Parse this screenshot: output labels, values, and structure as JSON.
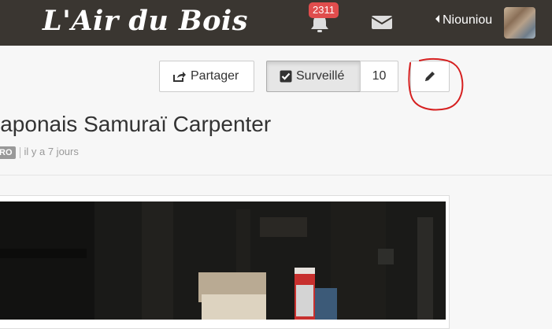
{
  "header": {
    "logo_text": "L'Air du Bois",
    "notification_count": "2311",
    "username": "Niouniou",
    "icons": [
      "bell-icon",
      "envelope-icon",
      "caret-left-icon",
      "avatar"
    ]
  },
  "toolbar": {
    "share_label": "Partager",
    "watch_label": "Surveillé",
    "watch_count": "10",
    "icons": [
      "share-icon",
      "checkbox-icon",
      "pencil-icon"
    ]
  },
  "post": {
    "title": "japonais Samuraï Carpenter",
    "tag": "RO",
    "time": "il y a 7 jours"
  },
  "colors": {
    "topbar": "#3a3631",
    "badge": "#e04d4d",
    "annotation": "#d62020"
  }
}
